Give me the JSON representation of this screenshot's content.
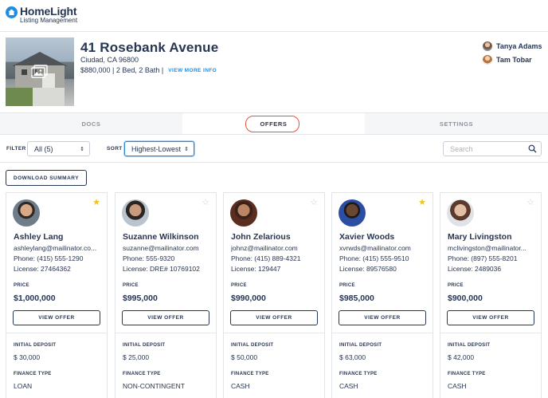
{
  "header": {
    "logo_name": "HomeLight",
    "logo_sub": "Listing Management"
  },
  "property": {
    "title": "41 Rosebank Avenue",
    "city": "Ciudad, CA 96800",
    "details": "$880,000 | 2 Bed, 2 Bath |",
    "view_more": "VIEW MORE INFO",
    "agents": [
      {
        "name": "Tanya Adams"
      },
      {
        "name": "Tam Tobar"
      }
    ]
  },
  "tabs": [
    {
      "label": "DOCS"
    },
    {
      "label": "OFFERS",
      "active": true
    },
    {
      "label": "SETTINGS"
    }
  ],
  "filters": {
    "filter_label": "FILTER",
    "filter_value": "All (5)",
    "sort_label": "SORT",
    "sort_value": "Highest-Lowest",
    "search_placeholder": "Search"
  },
  "download_label": "DOWNLOAD SUMMARY",
  "labels": {
    "price": "PRICE",
    "view_offer": "VIEW OFFER",
    "initial_deposit": "INITIAL DEPOSIT",
    "finance_type": "FINANCE TYPE"
  },
  "offers": [
    {
      "name": "Ashley Lang",
      "email": "ashleylang@mailinator.co...",
      "phone": "Phone: (415) 555-1290",
      "license": "License: 27464362",
      "price": "$1,000,000",
      "deposit": "$ 30,000",
      "finance": "LOAN",
      "starred": true
    },
    {
      "name": "Suzanne Wilkinson",
      "email": "suzanne@mailinator.com",
      "phone": "Phone: 555-9320",
      "license": "License: DRE# 10769102",
      "price": "$995,000",
      "deposit": "$ 25,000",
      "finance": "NON-CONTINGENT",
      "starred": false
    },
    {
      "name": "John Zelarious",
      "email": "johnz@mailinator.com",
      "phone": "Phone: (415) 889-4321",
      "license": "License: 129447",
      "price": "$990,000",
      "deposit": "$ 50,000",
      "finance": "CASH",
      "starred": false
    },
    {
      "name": "Xavier Woods",
      "email": "xvrwds@mailinator.com",
      "phone": "Phone: (415) 555-9510",
      "license": "License: 89576580",
      "price": "$985,000",
      "deposit": "$ 63,000",
      "finance": "CASH",
      "starred": true
    },
    {
      "name": "Mary Livingston",
      "email": "mclivingston@mailinator...",
      "phone": "Phone: (897) 555-8201",
      "license": "License: 2489036",
      "price": "$900,000",
      "deposit": "$ 42,000",
      "finance": "CASH",
      "starred": false
    }
  ],
  "colors": {
    "brand_blue": "#1f8de5",
    "navy": "#273653",
    "star_gold": "#f5c21b",
    "highlight_red": "#e5533d"
  }
}
